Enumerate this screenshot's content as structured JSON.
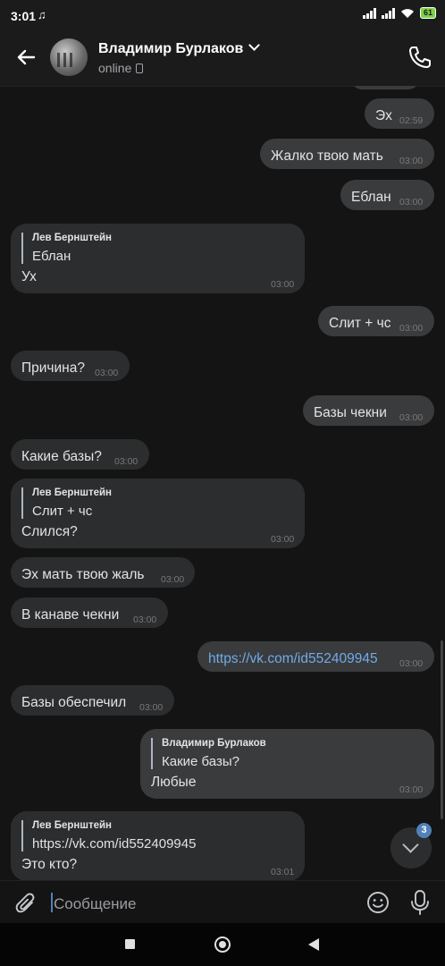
{
  "status": {
    "time": "3:01",
    "battery": "61"
  },
  "header": {
    "name": "Владимир Бурлаков",
    "status": "online"
  },
  "messages": [
    {
      "dir": "out",
      "text": "Эх",
      "time": "02:59"
    },
    {
      "dir": "out",
      "text": "Жалко твою мать",
      "time": "03:00"
    },
    {
      "dir": "out",
      "text": "Еблан",
      "time": "03:00"
    },
    {
      "dir": "in",
      "reply_author": "Лев Бернштейн",
      "reply_text": "Еблан",
      "text": "Ух",
      "time": "03:00"
    },
    {
      "dir": "out",
      "text": "Слит + чс",
      "time": "03:00"
    },
    {
      "dir": "in",
      "text": "Причина?",
      "time": "03:00"
    },
    {
      "dir": "out",
      "text": "Базы чекни",
      "time": "03:00"
    },
    {
      "dir": "in",
      "text": "Какие базы?",
      "time": "03:00"
    },
    {
      "dir": "in",
      "reply_author": "Лев Бернштейн",
      "reply_text": "Слит + чс",
      "text": "Слился?",
      "time": "03:00"
    },
    {
      "dir": "in",
      "text": "Эх мать твою жаль",
      "time": "03:00"
    },
    {
      "dir": "in",
      "text": "В канаве чекни",
      "time": "03:00"
    },
    {
      "dir": "out",
      "text": "https://vk.com/id552409945",
      "time": "03:00",
      "link": true
    },
    {
      "dir": "in",
      "text": "Базы обеспечил",
      "time": "03:00"
    },
    {
      "dir": "out",
      "reply_author": "Владимир Бурлаков",
      "reply_text": "Какие базы?",
      "text": "Любые",
      "time": "03:00"
    },
    {
      "dir": "in",
      "reply_author": "Лев Бернштейн",
      "reply_text": "https://vk.com/id552409945",
      "text": "Это кто?",
      "time": "03:01"
    }
  ],
  "scroll_down": {
    "unread_count": "3"
  },
  "composer": {
    "placeholder": "Сообщение"
  },
  "icons": [
    "back-arrow-icon",
    "phone-call-icon",
    "attach-icon",
    "emoji-icon",
    "mic-icon",
    "chevron-down-icon"
  ],
  "colors": {
    "background": "#141414",
    "bubble_in": "#2c2d2e",
    "bubble_out": "#3a3b3c",
    "link": "#71aaeb",
    "accent": "#5181b8"
  }
}
